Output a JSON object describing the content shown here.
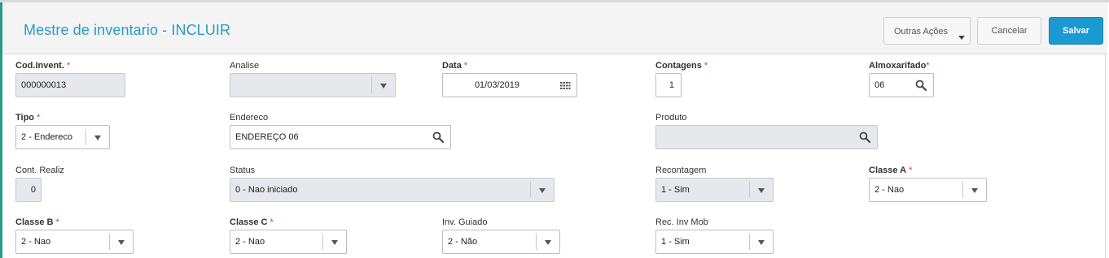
{
  "header": {
    "title": "Mestre de inventario - INCLUIR",
    "more_actions": "Outras Ações",
    "cancel": "Cancelar",
    "save": "Salvar"
  },
  "fields": {
    "cod_invent": {
      "label": "Cod.Invent.",
      "value": "000000013",
      "required": true
    },
    "analise": {
      "label": "Analise",
      "value": ""
    },
    "data": {
      "label": "Data",
      "value": "01/03/2019",
      "required": true
    },
    "contagens": {
      "label": "Contagens",
      "value": "1",
      "required": true
    },
    "almoxarifado": {
      "label": "Almoxarifado",
      "value": "06",
      "required": true
    },
    "tipo": {
      "label": "Tipo",
      "value": "2 - Endereco",
      "required": true
    },
    "endereco": {
      "label": "Endereco",
      "value": "ENDEREÇO 06"
    },
    "produto": {
      "label": "Produto",
      "value": ""
    },
    "cont_realiz": {
      "label": "Cont. Realiz",
      "value": "0"
    },
    "status": {
      "label": "Status",
      "value": "0 - Nao iniciado"
    },
    "recontagem": {
      "label": "Recontagem",
      "value": "1 - Sim"
    },
    "classe_a": {
      "label": "Classe A",
      "value": "2 - Nao",
      "required": true
    },
    "classe_b": {
      "label": "Classe B",
      "value": "2 - Nao",
      "required": true
    },
    "classe_c": {
      "label": "Classe C",
      "value": "2 - Nao",
      "required": true
    },
    "inv_guiado": {
      "label": "Inv. Guiado",
      "value": "2 - Não"
    },
    "rec_inv_mob": {
      "label": "Rec. Inv Mob",
      "value": "1 - Sim"
    }
  },
  "required_marker": "*",
  "colors": {
    "accent": "#2b9bc4",
    "save_button": "#1a9ad1",
    "required": "#e03333",
    "disabled_field": "#e6e8ee"
  }
}
